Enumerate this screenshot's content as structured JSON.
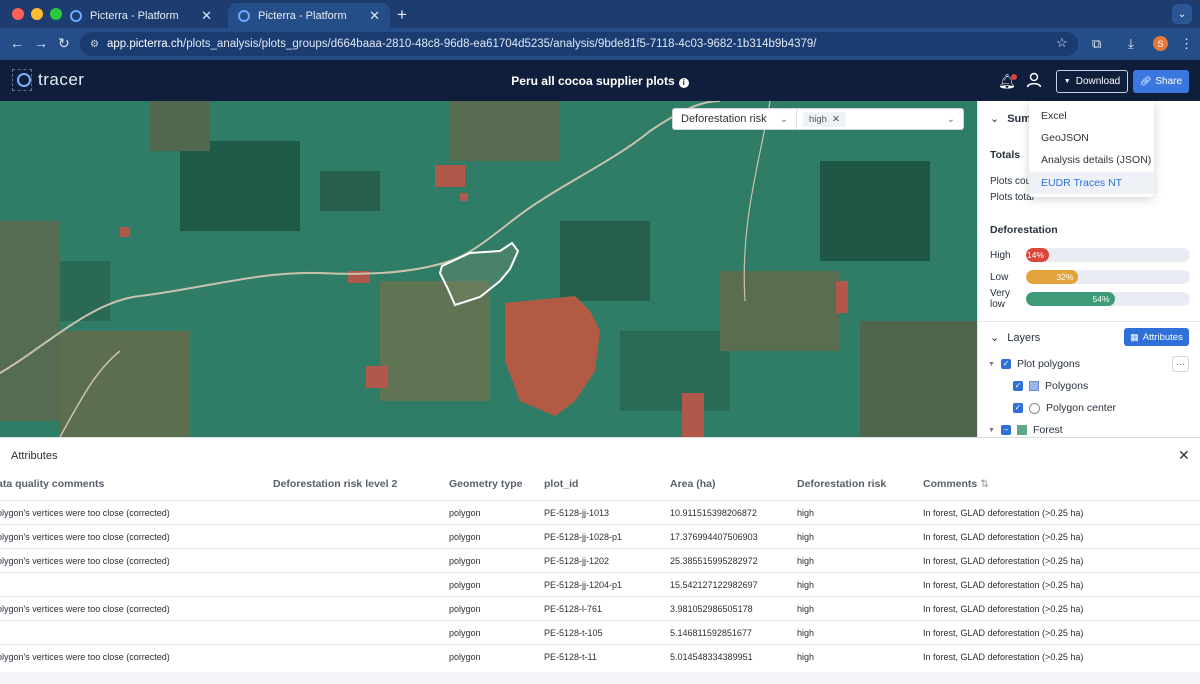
{
  "browser": {
    "tabs": [
      {
        "title": "Picterra - Platform",
        "active": false
      },
      {
        "title": "Picterra - Platform",
        "active": true
      }
    ],
    "url_host": "app.picterra.ch",
    "url_path": "/plots_analysis/plots_groups/d664baaa-2810-48c8-96d8-ea61704d5235/analysis/9bde81f5-7118-4c03-9682-1b314b9b4379/",
    "profile_initial": "S"
  },
  "header": {
    "logo_text": "tracer",
    "title": "Peru all cocoa supplier plots",
    "download_label": "Download",
    "share_label": "Share"
  },
  "download_menu": {
    "items": [
      "Excel",
      "GeoJSON",
      "Analysis details (JSON)",
      "EUDR Traces NT"
    ],
    "selected_index": 3
  },
  "map_filter": {
    "field": "Deforestation risk",
    "value": "high"
  },
  "summary": {
    "heading": "Summ",
    "totals_label": "Totals",
    "plots_count_label": "Plots cour",
    "plots_total_label": "Plots total"
  },
  "deforestation": {
    "heading": "Deforestation",
    "levels": [
      {
        "label": "High",
        "percent": 14,
        "text": "14%",
        "color": "#d9473a"
      },
      {
        "label": "Low",
        "percent": 32,
        "text": "32%",
        "color": "#e4a33d"
      },
      {
        "label": "Very low",
        "percent": 54,
        "text": "54%",
        "color": "#3f9a77"
      }
    ]
  },
  "layers": {
    "heading": "Layers",
    "attributes_button": "Attributes",
    "items": [
      {
        "label": "Plot polygons",
        "level": 0
      },
      {
        "label": "Polygons",
        "level": 1
      },
      {
        "label": "Polygon center",
        "level": 1
      },
      {
        "label": "Forest",
        "level": 0
      }
    ]
  },
  "attributes": {
    "title": "Attributes",
    "columns": [
      "ata quality comments",
      "Deforestation risk level 2",
      "Geometry type",
      "plot_id",
      "Area (ha)",
      "Deforestation risk",
      "Comments"
    ],
    "rows": [
      [
        "olygon's vertices were too close (corrected)",
        "",
        "polygon",
        "PE-5128-jj-1013",
        "10.911515398206872",
        "high",
        "In forest, GLAD deforestation (>0.25 ha)"
      ],
      [
        "olygon's vertices were too close (corrected)",
        "",
        "polygon",
        "PE-5128-jj-1028-p1",
        "17.376994407506903",
        "high",
        "In forest, GLAD deforestation (>0.25 ha)"
      ],
      [
        "olygon's vertices were too close (corrected)",
        "",
        "polygon",
        "PE-5128-jj-1202",
        "25.385515995282972",
        "high",
        "In forest, GLAD deforestation (>0.25 ha)"
      ],
      [
        "",
        "",
        "polygon",
        "PE-5128-jj-1204-p1",
        "15.542127122982697",
        "high",
        "In forest, GLAD deforestation (>0.25 ha)"
      ],
      [
        "olygon's vertices were too close (corrected)",
        "",
        "polygon",
        "PE-5128-l-761",
        "3.981052986505178",
        "high",
        "In forest, GLAD deforestation (>0.25 ha)"
      ],
      [
        "",
        "",
        "polygon",
        "PE-5128-t-105",
        "5.146811592851677",
        "high",
        "In forest, GLAD deforestation (>0.25 ha)"
      ],
      [
        "olygon's vertices were too close (corrected)",
        "",
        "polygon",
        "PE-5128-t-11",
        "5.014548334389951",
        "high",
        "In forest, GLAD deforestation (>0.25 ha)"
      ]
    ]
  }
}
